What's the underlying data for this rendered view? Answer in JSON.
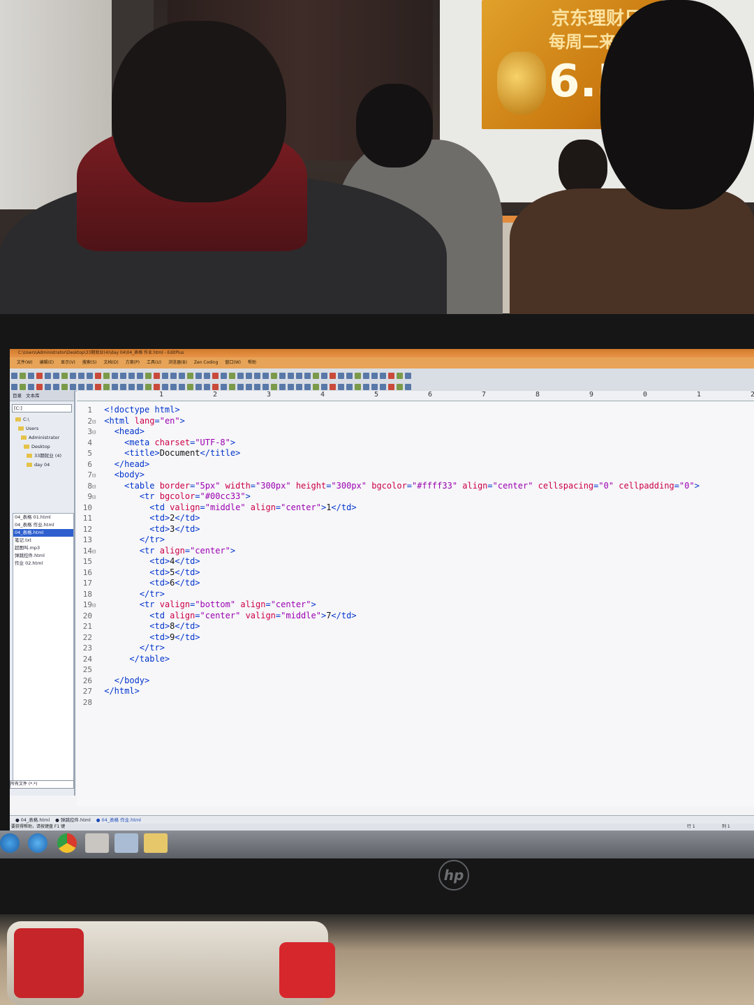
{
  "photo": {
    "ad_line1": "京东理财日",
    "ad_line2": "每周二来",
    "ad_rate": "6.5"
  },
  "window": {
    "title": "C:\\Users\\Administrator\\Desktop\\33期就业(4)\\day 04\\04_表格 作业.html - EditPlus",
    "menu": [
      "文件(W)",
      "编辑(E)",
      "显示(V)",
      "搜索(S)",
      "文档(D)",
      "方案(P)",
      "工具(U)",
      "浏览器(B)",
      "Zen Coding",
      "窗口(W)",
      "帮助"
    ]
  },
  "ruler": {
    "ticks": [
      "1",
      "2",
      "3",
      "4",
      "5",
      "6",
      "7",
      "8",
      "9",
      "0",
      "1",
      "2"
    ]
  },
  "sidebar": {
    "tab1": "目录",
    "tab2": "文本库",
    "drive": "[C:]",
    "tree": [
      "C:\\",
      "Users",
      "Administrator",
      "Desktop",
      "33期就业 (4)",
      "day 04"
    ],
    "files": [
      "04_表格 01.html",
      "04_表格 作业.html",
      "04_表格.html",
      "笔记.txt",
      "超图叫.mp3",
      "弹跳控件.html",
      "作业 02.html"
    ],
    "selected_index": 2,
    "filter": "所有文件 (*.*)"
  },
  "code_lines": [
    {
      "n": "1",
      "fold": false,
      "tokens": [
        [
          "tag",
          "<!doctype html>"
        ]
      ]
    },
    {
      "n": "2",
      "fold": true,
      "tokens": [
        [
          "tag",
          "<html "
        ],
        [
          "attr",
          "lang"
        ],
        [
          "tag",
          "="
        ],
        [
          "val",
          "\"en\""
        ],
        [
          "tag",
          ">"
        ]
      ]
    },
    {
      "n": "3",
      "fold": true,
      "tokens": [
        [
          "text",
          "  "
        ],
        [
          "tag",
          "<head>"
        ]
      ]
    },
    {
      "n": "4",
      "fold": false,
      "tokens": [
        [
          "text",
          "    "
        ],
        [
          "tag",
          "<meta "
        ],
        [
          "attr",
          "charset"
        ],
        [
          "tag",
          "="
        ],
        [
          "val",
          "\"UTF-8\""
        ],
        [
          "tag",
          ">"
        ]
      ]
    },
    {
      "n": "5",
      "fold": false,
      "tokens": [
        [
          "text",
          "    "
        ],
        [
          "tag",
          "<title>"
        ],
        [
          "text",
          "Document"
        ],
        [
          "tag",
          "</title>"
        ]
      ]
    },
    {
      "n": "6",
      "fold": false,
      "tokens": [
        [
          "text",
          "  "
        ],
        [
          "tag",
          "</head>"
        ]
      ]
    },
    {
      "n": "7",
      "fold": true,
      "tokens": [
        [
          "text",
          "  "
        ],
        [
          "tag",
          "<body>"
        ]
      ]
    },
    {
      "n": "8",
      "fold": true,
      "tokens": [
        [
          "text",
          "    "
        ],
        [
          "tag",
          "<table "
        ],
        [
          "attr",
          "border"
        ],
        [
          "tag",
          "="
        ],
        [
          "val",
          "\"5px\" "
        ],
        [
          "attr",
          "width"
        ],
        [
          "tag",
          "="
        ],
        [
          "val",
          "\"300px\" "
        ],
        [
          "attr",
          "height"
        ],
        [
          "tag",
          "="
        ],
        [
          "val",
          "\"300px\" "
        ],
        [
          "attr",
          "bgcolor"
        ],
        [
          "tag",
          "="
        ],
        [
          "val",
          "\"#ffff33\" "
        ],
        [
          "attr",
          "align"
        ],
        [
          "tag",
          "="
        ],
        [
          "val",
          "\"center\" "
        ],
        [
          "attr",
          "cellspacing"
        ],
        [
          "tag",
          "="
        ],
        [
          "val",
          "\"0\" "
        ],
        [
          "attr",
          "cellpadding"
        ],
        [
          "tag",
          "="
        ],
        [
          "val",
          "\"0\""
        ],
        [
          "tag",
          ">"
        ]
      ]
    },
    {
      "n": "9",
      "fold": true,
      "tokens": [
        [
          "text",
          "       "
        ],
        [
          "tag",
          "<tr "
        ],
        [
          "attr",
          "bgcolor"
        ],
        [
          "tag",
          "="
        ],
        [
          "val",
          "\"#00cc33\""
        ],
        [
          "tag",
          ">"
        ]
      ]
    },
    {
      "n": "10",
      "fold": false,
      "tokens": [
        [
          "text",
          "         "
        ],
        [
          "tag",
          "<td "
        ],
        [
          "attr",
          "valign"
        ],
        [
          "tag",
          "="
        ],
        [
          "val",
          "\"middle\" "
        ],
        [
          "attr",
          "align"
        ],
        [
          "tag",
          "="
        ],
        [
          "val",
          "\"center\""
        ],
        [
          "tag",
          ">"
        ],
        [
          "text",
          "1"
        ],
        [
          "tag",
          "</td>"
        ]
      ]
    },
    {
      "n": "11",
      "fold": false,
      "tokens": [
        [
          "text",
          "         "
        ],
        [
          "tag",
          "<td>"
        ],
        [
          "text",
          "2"
        ],
        [
          "tag",
          "</td>"
        ]
      ]
    },
    {
      "n": "12",
      "fold": false,
      "tokens": [
        [
          "text",
          "         "
        ],
        [
          "tag",
          "<td>"
        ],
        [
          "text",
          "3"
        ],
        [
          "tag",
          "</td>"
        ]
      ]
    },
    {
      "n": "13",
      "fold": false,
      "tokens": [
        [
          "text",
          "       "
        ],
        [
          "tag",
          "</tr>"
        ]
      ]
    },
    {
      "n": "14",
      "fold": true,
      "tokens": [
        [
          "text",
          "       "
        ],
        [
          "tag",
          "<tr "
        ],
        [
          "attr",
          "align"
        ],
        [
          "tag",
          "="
        ],
        [
          "val",
          "\"center\""
        ],
        [
          "tag",
          ">"
        ]
      ]
    },
    {
      "n": "15",
      "fold": false,
      "tokens": [
        [
          "text",
          "         "
        ],
        [
          "tag",
          "<td>"
        ],
        [
          "text",
          "4"
        ],
        [
          "tag",
          "</td>"
        ]
      ]
    },
    {
      "n": "16",
      "fold": false,
      "tokens": [
        [
          "text",
          "         "
        ],
        [
          "tag",
          "<td>"
        ],
        [
          "text",
          "5"
        ],
        [
          "tag",
          "</td>"
        ]
      ]
    },
    {
      "n": "17",
      "fold": false,
      "tokens": [
        [
          "text",
          "         "
        ],
        [
          "tag",
          "<td>"
        ],
        [
          "text",
          "6"
        ],
        [
          "tag",
          "</td>"
        ]
      ]
    },
    {
      "n": "18",
      "fold": false,
      "tokens": [
        [
          "text",
          "       "
        ],
        [
          "tag",
          "</tr>"
        ]
      ]
    },
    {
      "n": "19",
      "fold": true,
      "tokens": [
        [
          "text",
          "       "
        ],
        [
          "tag",
          "<tr "
        ],
        [
          "attr",
          "valign"
        ],
        [
          "tag",
          "="
        ],
        [
          "val",
          "\"bottom\" "
        ],
        [
          "attr",
          "align"
        ],
        [
          "tag",
          "="
        ],
        [
          "val",
          "\"center\""
        ],
        [
          "tag",
          ">"
        ]
      ]
    },
    {
      "n": "20",
      "fold": false,
      "tokens": [
        [
          "text",
          "         "
        ],
        [
          "tag",
          "<td "
        ],
        [
          "attr",
          "align"
        ],
        [
          "tag",
          "="
        ],
        [
          "val",
          "\"center\" "
        ],
        [
          "attr",
          "valign"
        ],
        [
          "tag",
          "="
        ],
        [
          "val",
          "\"middle\""
        ],
        [
          "tag",
          ">"
        ],
        [
          "text",
          "7"
        ],
        [
          "tag",
          "</td>"
        ]
      ]
    },
    {
      "n": "21",
      "fold": false,
      "tokens": [
        [
          "text",
          "         "
        ],
        [
          "tag",
          "<td>"
        ],
        [
          "text",
          "8"
        ],
        [
          "tag",
          "</td>"
        ]
      ]
    },
    {
      "n": "22",
      "fold": false,
      "tokens": [
        [
          "text",
          "         "
        ],
        [
          "tag",
          "<td>"
        ],
        [
          "text",
          "9"
        ],
        [
          "tag",
          "</td>"
        ]
      ]
    },
    {
      "n": "23",
      "fold": false,
      "tokens": [
        [
          "text",
          "       "
        ],
        [
          "tag",
          "</tr>"
        ]
      ]
    },
    {
      "n": "24",
      "fold": false,
      "tokens": [
        [
          "text",
          "     "
        ],
        [
          "tag",
          "</table>"
        ]
      ]
    },
    {
      "n": "25",
      "fold": false,
      "tokens": []
    },
    {
      "n": "26",
      "fold": false,
      "tokens": [
        [
          "text",
          "  "
        ],
        [
          "tag",
          "</body>"
        ]
      ]
    },
    {
      "n": "27",
      "fold": false,
      "tokens": [
        [
          "tag",
          "</html>"
        ]
      ]
    },
    {
      "n": "28",
      "fold": false,
      "tokens": []
    }
  ],
  "doc_tabs": [
    "04_表格.html",
    "弹跳控件.html",
    "04_表格 作业.html"
  ],
  "active_doc_index": 2,
  "status": {
    "hint": "要获得帮助，请按键盘 F1 键",
    "line": "行 1",
    "col": "列 1"
  },
  "colors": {
    "tag": "#0033cc",
    "attr": "#cc0044",
    "value": "#9a00b0",
    "titlebar": "#e08a3a",
    "selection": "#2d5fcf"
  },
  "monitor_brand": "hp"
}
